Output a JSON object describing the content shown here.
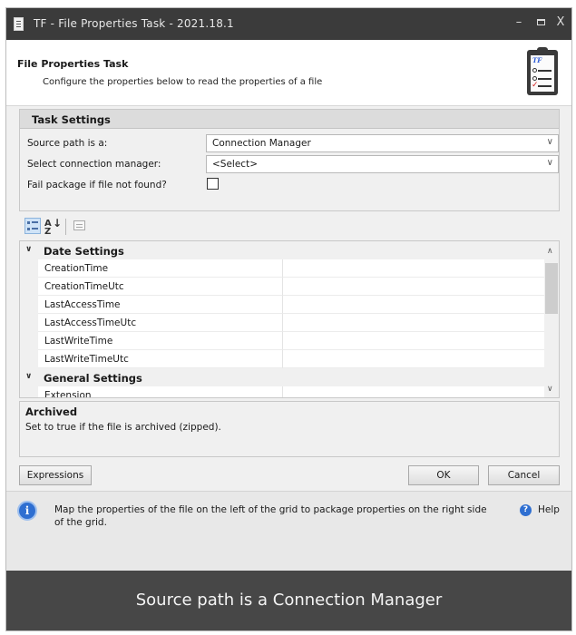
{
  "window": {
    "title": "TF - File Properties Task - 2021.18.1",
    "minimize_glyph": "–",
    "close_glyph": "X"
  },
  "header": {
    "title": "File Properties Task",
    "subtitle": "Configure the properties below to read the properties of a file",
    "icon": "clipboard-checklist-icon",
    "icon_badge": "TF"
  },
  "task_settings": {
    "heading": "Task Settings",
    "source_path_label": "Source path is a:",
    "source_path_value": "Connection Manager",
    "connection_manager_label": "Select connection manager:",
    "connection_manager_value": "<Select>",
    "fail_if_not_found_label": "Fail package if file not found?",
    "fail_if_not_found_checked": false
  },
  "toolbar": {
    "categorized_icon": "categorized-view-icon",
    "az_icon": "sort-alphabetical-icon",
    "az_text": "A Z",
    "pages_icon": "property-pages-icon"
  },
  "grid": {
    "categories": [
      {
        "label": "Date Settings",
        "expanded": true,
        "items": [
          "CreationTime",
          "CreationTimeUtc",
          "LastAccessTime",
          "LastAccessTimeUtc",
          "LastWriteTime",
          "LastWriteTimeUtc"
        ]
      },
      {
        "label": "General Settings",
        "expanded": true,
        "items": [
          "Extension"
        ]
      }
    ]
  },
  "description": {
    "title": "Archived",
    "text": "Set to true if the file is archived (zipped)."
  },
  "buttons": {
    "expressions": "Expressions",
    "ok": "OK",
    "cancel": "Cancel"
  },
  "footer": {
    "info_text": "Map the properties of the file on the left of the grid to package properties on the right side of the grid.",
    "help_label": "Help",
    "help_icon_glyph": "?",
    "info_icon_glyph": "i"
  },
  "caption": "Source path is a Connection Manager",
  "colors": {
    "titlebar": "#3b3b3b",
    "caption_bar": "#474747",
    "accent_blue": "#2f6fd1"
  }
}
